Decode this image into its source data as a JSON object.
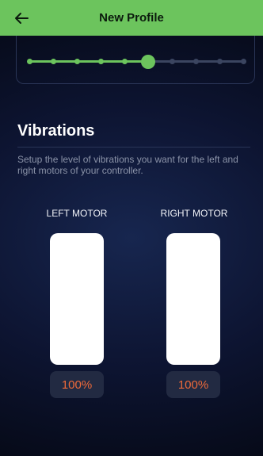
{
  "header": {
    "title": "New Profile",
    "back_icon": "arrow-left-icon"
  },
  "stepper": {
    "total_steps": 10,
    "current_step": 6,
    "active_color": "#6cc45d",
    "inactive_color": "#3b4560"
  },
  "section": {
    "title": "Vibrations",
    "description": "Setup the level of vibrations you want for the left and right motors of your controller."
  },
  "motors": [
    {
      "label": "LEFT MOTOR",
      "value": "100%",
      "level": 1.0
    },
    {
      "label": "RIGHT MOTOR",
      "value": "100%",
      "level": 1.0
    }
  ],
  "colors": {
    "accent": "#6cc45d",
    "value_text": "#ef6a3a"
  }
}
